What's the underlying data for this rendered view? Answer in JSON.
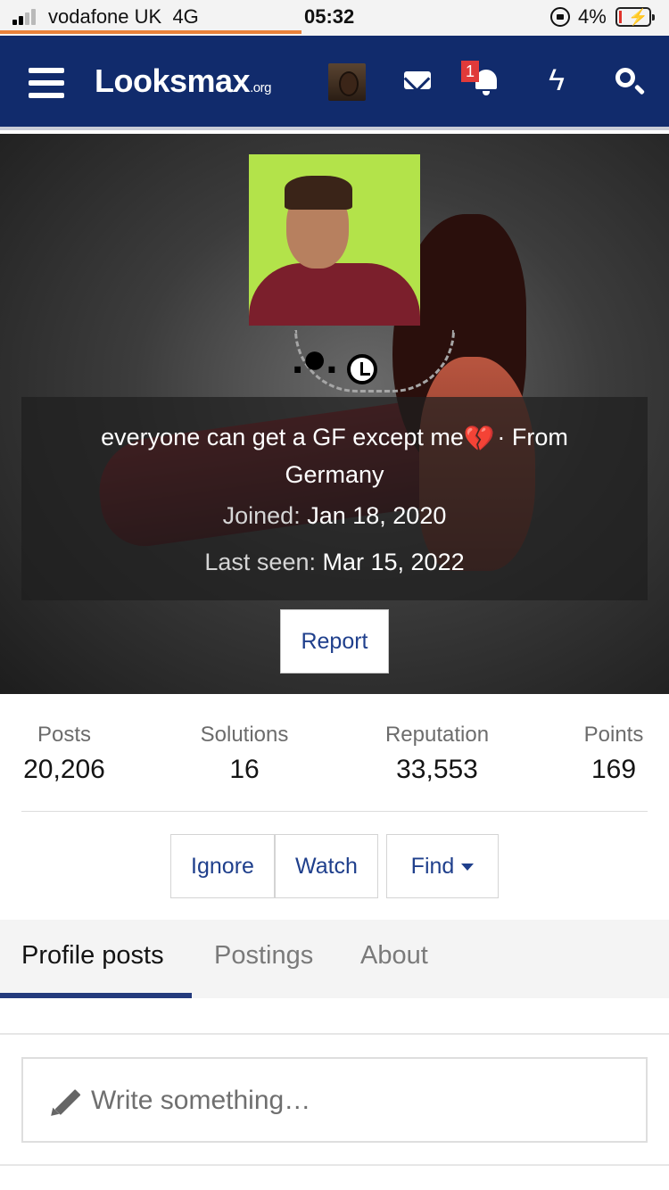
{
  "status_bar": {
    "carrier": "vodafone UK",
    "network": "4G",
    "time": "05:32",
    "battery_percent": "4%",
    "page_load_progress": 0.45
  },
  "header": {
    "logo_main": "Looksmax",
    "logo_suffix": ".org",
    "notification_count": "1",
    "icons": [
      "menu-icon",
      "avatar",
      "mail-icon",
      "bell-icon",
      "flash-icon",
      "search-icon"
    ]
  },
  "profile": {
    "username": ".●.",
    "status_text": "everyone can get a GF except me",
    "status_emoji": "💔",
    "from_text": "· From Germany",
    "joined_label": "Joined:",
    "joined_value": "Jan 18, 2020",
    "last_seen_label": "Last seen:",
    "last_seen_value": "Mar 15, 2022",
    "report_label": "Report"
  },
  "stats": [
    {
      "label": "Posts",
      "value": "20,206"
    },
    {
      "label": "Solutions",
      "value": "16"
    },
    {
      "label": "Reputation",
      "value": "33,553"
    },
    {
      "label": "Points",
      "value": "169"
    }
  ],
  "actions": {
    "ignore_label": "Ignore",
    "watch_label": "Watch",
    "find_label": "Find"
  },
  "tabs": [
    {
      "label": "Profile posts",
      "active": true
    },
    {
      "label": "Postings",
      "active": false
    },
    {
      "label": "About",
      "active": false
    }
  ],
  "composer": {
    "placeholder": "Write something…"
  },
  "colors": {
    "header_bg": "#112b6c",
    "accent_link": "#1f3f8c",
    "progress": "#e8823b",
    "badge": "#e03a3a"
  }
}
